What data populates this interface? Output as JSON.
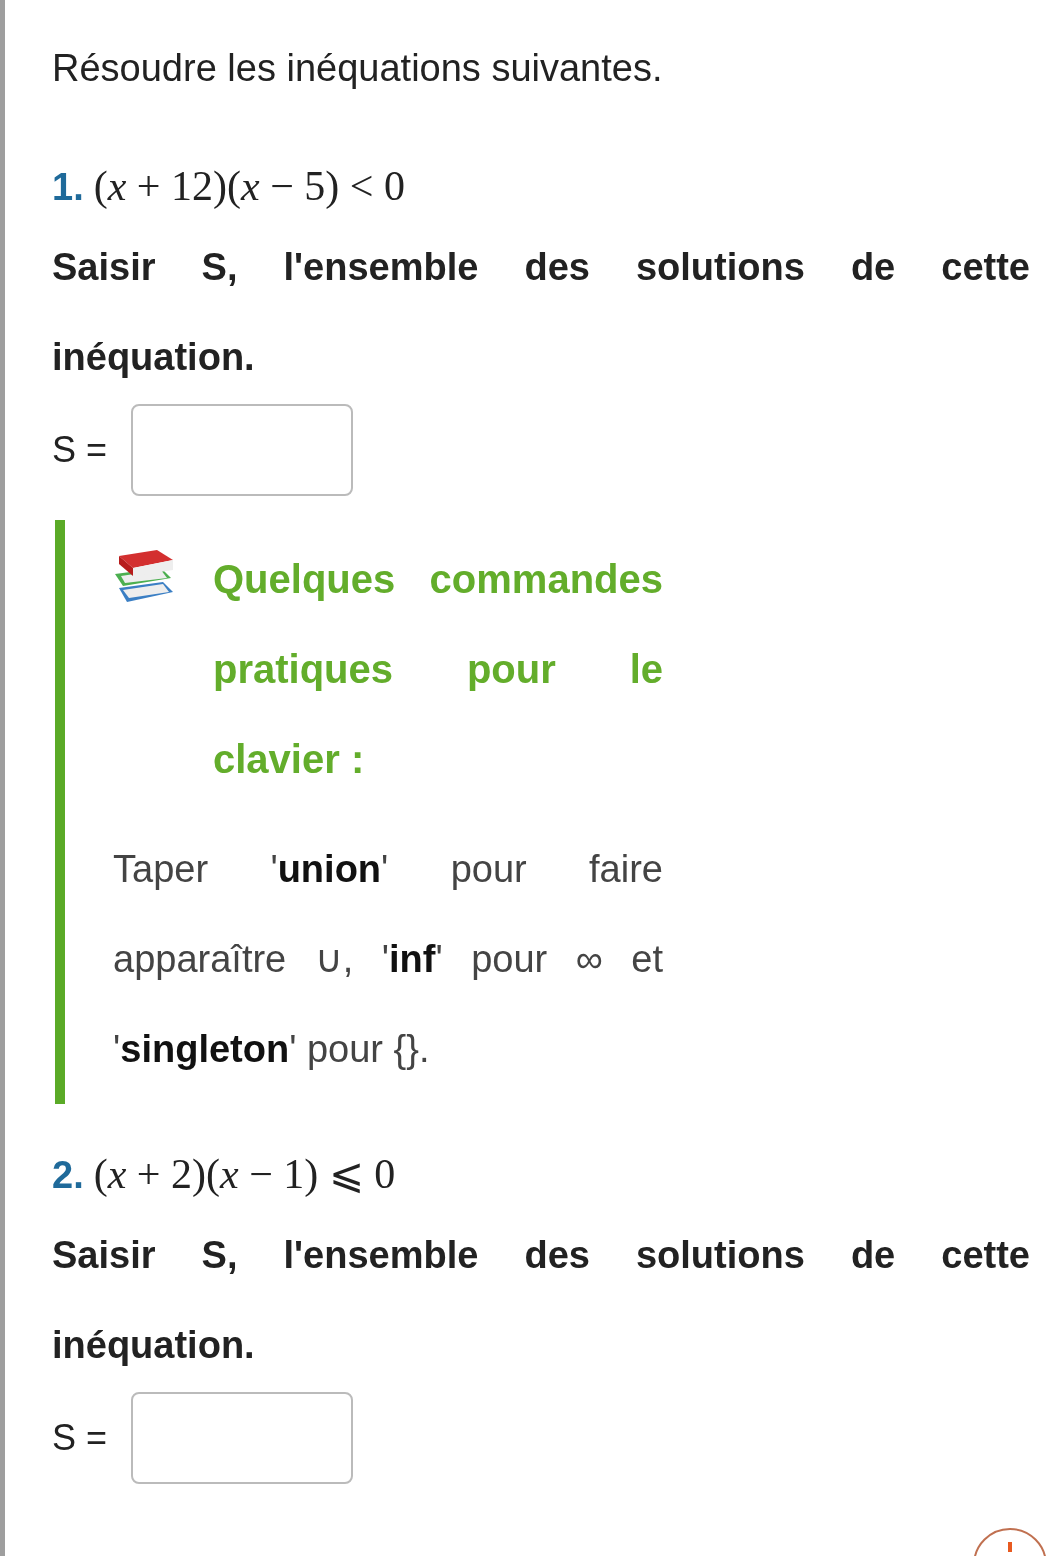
{
  "instruction": "Résoudre les inéquations suivantes.",
  "items": [
    {
      "number": "1.",
      "expression": "(*x* + 12)(*x* − 5) < 0",
      "prompt": "Saisir S, l'ensemble des solutions de cette inéquation.",
      "answer_label": "S =",
      "tip": {
        "title": "Quelques commandes pratiques pour le clavier :",
        "text": "Taper '**union**' pour faire apparaître ∪, '**inf**' pour ∞ et '**singleton**' pour {}."
      }
    },
    {
      "number": "2.",
      "expression": "(*x* + 2)(*x* − 1) ⩽ 0",
      "prompt": "Saisir S, l'ensemble des solutions de cette inéquation.",
      "answer_label": "S ="
    }
  ]
}
